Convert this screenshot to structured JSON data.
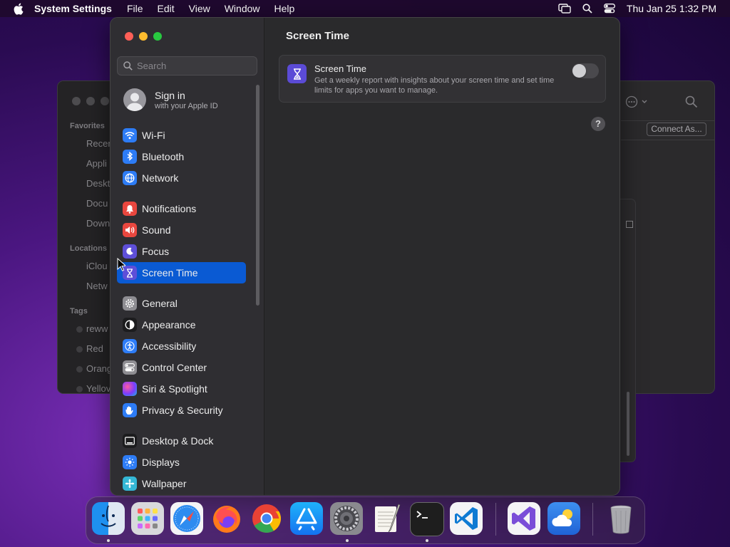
{
  "menubar": {
    "app_name": "System Settings",
    "menus": [
      "File",
      "Edit",
      "View",
      "Window",
      "Help"
    ],
    "clock": "Thu Jan 25  1:32 PM",
    "status_icons": [
      "screen-mirroring-icon",
      "spotlight-search-icon",
      "control-center-icon"
    ]
  },
  "finder": {
    "sections": {
      "favorites": "Favorites",
      "locations": "Locations",
      "tags": "Tags"
    },
    "favorites": [
      "Recen",
      "Appli",
      "Deskt",
      "Docu",
      "Down"
    ],
    "locations": [
      "iClou",
      "Netw"
    ],
    "tags": [
      "reww",
      "Red",
      "Orang",
      "Yellov"
    ],
    "connect_button": "Connect As..."
  },
  "settings": {
    "search": {
      "placeholder": "Search",
      "value": ""
    },
    "signin": {
      "title": "Sign in",
      "subtitle": "with your Apple ID"
    },
    "groups": [
      [
        {
          "label": "Wi-Fi",
          "icon": "wifi-icon",
          "color": "#2d7cf6"
        },
        {
          "label": "Bluetooth",
          "icon": "bluetooth-icon",
          "color": "#2d7cf6"
        },
        {
          "label": "Network",
          "icon": "network-globe-icon",
          "color": "#2d7cf6"
        }
      ],
      [
        {
          "label": "Notifications",
          "icon": "notifications-bell-icon",
          "color": "#e9473f"
        },
        {
          "label": "Sound",
          "icon": "sound-speaker-icon",
          "color": "#e9473f"
        },
        {
          "label": "Focus",
          "icon": "focus-moon-icon",
          "color": "#5e4fd8"
        },
        {
          "label": "Screen Time",
          "icon": "hourglass-icon",
          "color": "#5e4fd8",
          "selected": true
        }
      ],
      [
        {
          "label": "General",
          "icon": "gear-icon",
          "color": "#8e8d92"
        },
        {
          "label": "Appearance",
          "icon": "appearance-icon",
          "color": "#1c1c1e"
        },
        {
          "label": "Accessibility",
          "icon": "accessibility-icon",
          "color": "#2d7cf6"
        },
        {
          "label": "Control Center",
          "icon": "control-center-icon",
          "color": "#8e8d92"
        },
        {
          "label": "Siri & Spotlight",
          "icon": "siri-icon",
          "color": "#b23ad0"
        },
        {
          "label": "Privacy & Security",
          "icon": "privacy-hand-icon",
          "color": "#2d7cf6"
        }
      ],
      [
        {
          "label": "Desktop & Dock",
          "icon": "desktop-dock-icon",
          "color": "#1c1c1e"
        },
        {
          "label": "Displays",
          "icon": "displays-sun-icon",
          "color": "#2d7cf6"
        },
        {
          "label": "Wallpaper",
          "icon": "wallpaper-icon",
          "color": "#34b7d6"
        }
      ]
    ],
    "page_title": "Screen Time",
    "card": {
      "title": "Screen Time",
      "description": "Get a weekly report with insights about your screen time and set time limits for apps you want to manage.",
      "toggle_on": false
    },
    "help": "?"
  },
  "dock": {
    "apps": [
      {
        "name": "finder",
        "icon": "finder-icon",
        "running": true
      },
      {
        "name": "launchpad",
        "icon": "launchpad-icon",
        "running": false
      },
      {
        "name": "safari",
        "icon": "safari-icon",
        "running": false
      },
      {
        "name": "firefox",
        "icon": "firefox-icon",
        "running": false
      },
      {
        "name": "chrome",
        "icon": "chrome-icon",
        "running": false
      },
      {
        "name": "app-store",
        "icon": "app-store-icon",
        "running": false
      },
      {
        "name": "system-settings",
        "icon": "system-settings-icon",
        "running": true
      },
      {
        "name": "textedit",
        "icon": "textedit-icon",
        "running": false
      },
      {
        "name": "terminal",
        "icon": "terminal-icon",
        "running": true
      },
      {
        "name": "vscode",
        "icon": "vscode-icon",
        "running": false
      },
      {
        "name": "visual-studio",
        "icon": "visual-studio-icon",
        "running": false
      },
      {
        "name": "weather",
        "icon": "weather-icon",
        "running": false
      },
      {
        "name": "trash",
        "icon": "trash-icon",
        "running": false
      }
    ]
  },
  "colors": {
    "accent": "#0a5ad3",
    "screen_time_purple": "#5b4bd6",
    "close": "#ff5f57",
    "minimize": "#febc2e",
    "zoom": "#28c840"
  }
}
